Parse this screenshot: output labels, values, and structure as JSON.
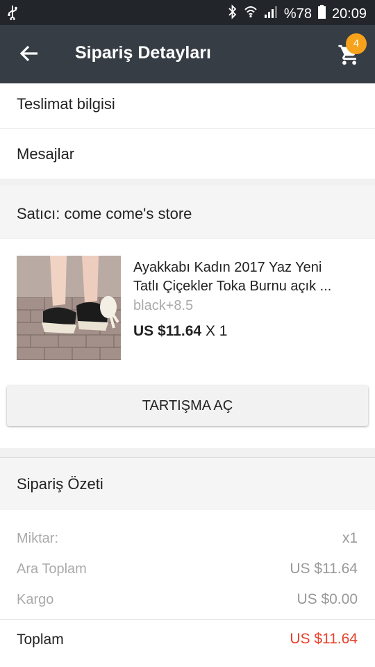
{
  "status_bar": {
    "battery": "%78",
    "time": "20:09",
    "icons": [
      "usb-icon",
      "bluetooth-icon",
      "wifi-icon",
      "signal-icon",
      "battery-icon"
    ]
  },
  "app_bar": {
    "title": "Sipariş Detayları",
    "cart_badge": "4",
    "accent_color": "#f7a21b",
    "background_color": "#363d45"
  },
  "menu": {
    "delivery_info": "Teslimat bilgisi",
    "messages": "Mesajlar"
  },
  "seller": {
    "label": "Satıcı: come come's store"
  },
  "product": {
    "title_line1": "Ayakkabı Kadın 2017 Yaz Yeni",
    "title_line2": "Tatlı Çiçekler Toka Burnu açık ...",
    "variant": "black+8.5",
    "price": "US $11.64",
    "quantity": "X 1"
  },
  "dispute_button": "TARTIŞMA AÇ",
  "summary": {
    "title": "Sipariş Özeti",
    "quantity_label": "Miktar:",
    "quantity_value": "x1",
    "subtotal_label": "Ara Toplam",
    "subtotal_value": "US $11.64",
    "shipping_label": "Kargo",
    "shipping_value": "US $0.00",
    "total_label": "Toplam",
    "total_value": "US $11.64",
    "total_color": "#e8412c"
  }
}
